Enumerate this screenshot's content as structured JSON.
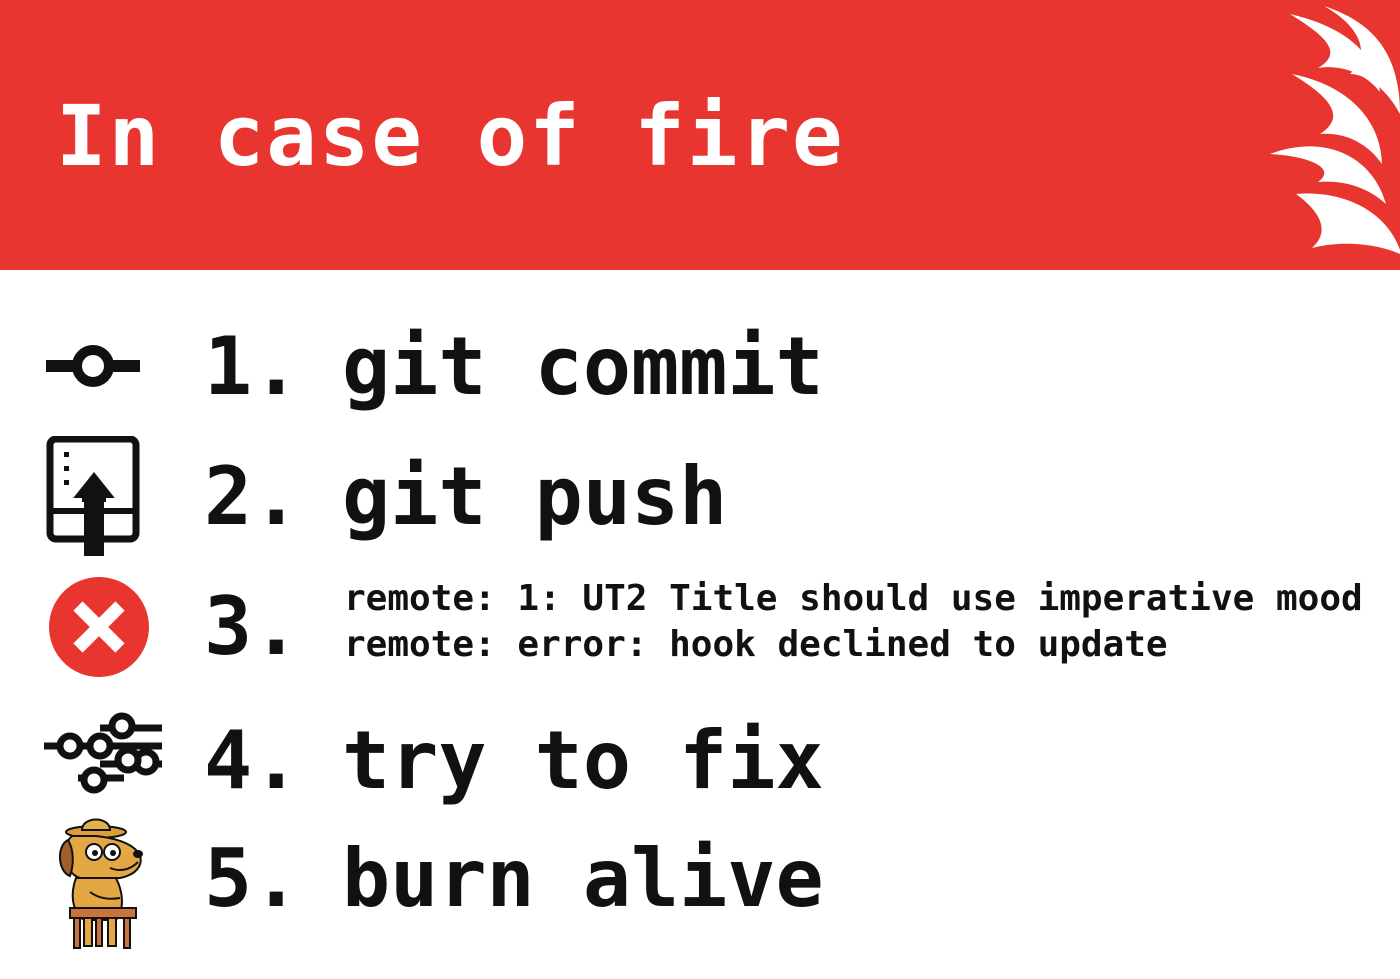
{
  "banner": {
    "title": "In case of fire",
    "icon": "flame-icon",
    "color": "#e83530"
  },
  "steps": [
    {
      "number": "1.",
      "text": "git commit",
      "icon": "git-commit-icon"
    },
    {
      "number": "2.",
      "text": "git push",
      "icon": "git-push-icon"
    },
    {
      "number": "3.",
      "lines": [
        "remote: 1: UT2 Title should use imperative mood",
        "remote: error: hook declined to update"
      ],
      "icon": "error-x-icon",
      "icon_color": "#e83530"
    },
    {
      "number": "4.",
      "text": "try to fix",
      "icon": "git-branches-icon"
    },
    {
      "number": "5.",
      "text": "burn alive",
      "icon": "this-is-fine-dog-icon"
    }
  ]
}
